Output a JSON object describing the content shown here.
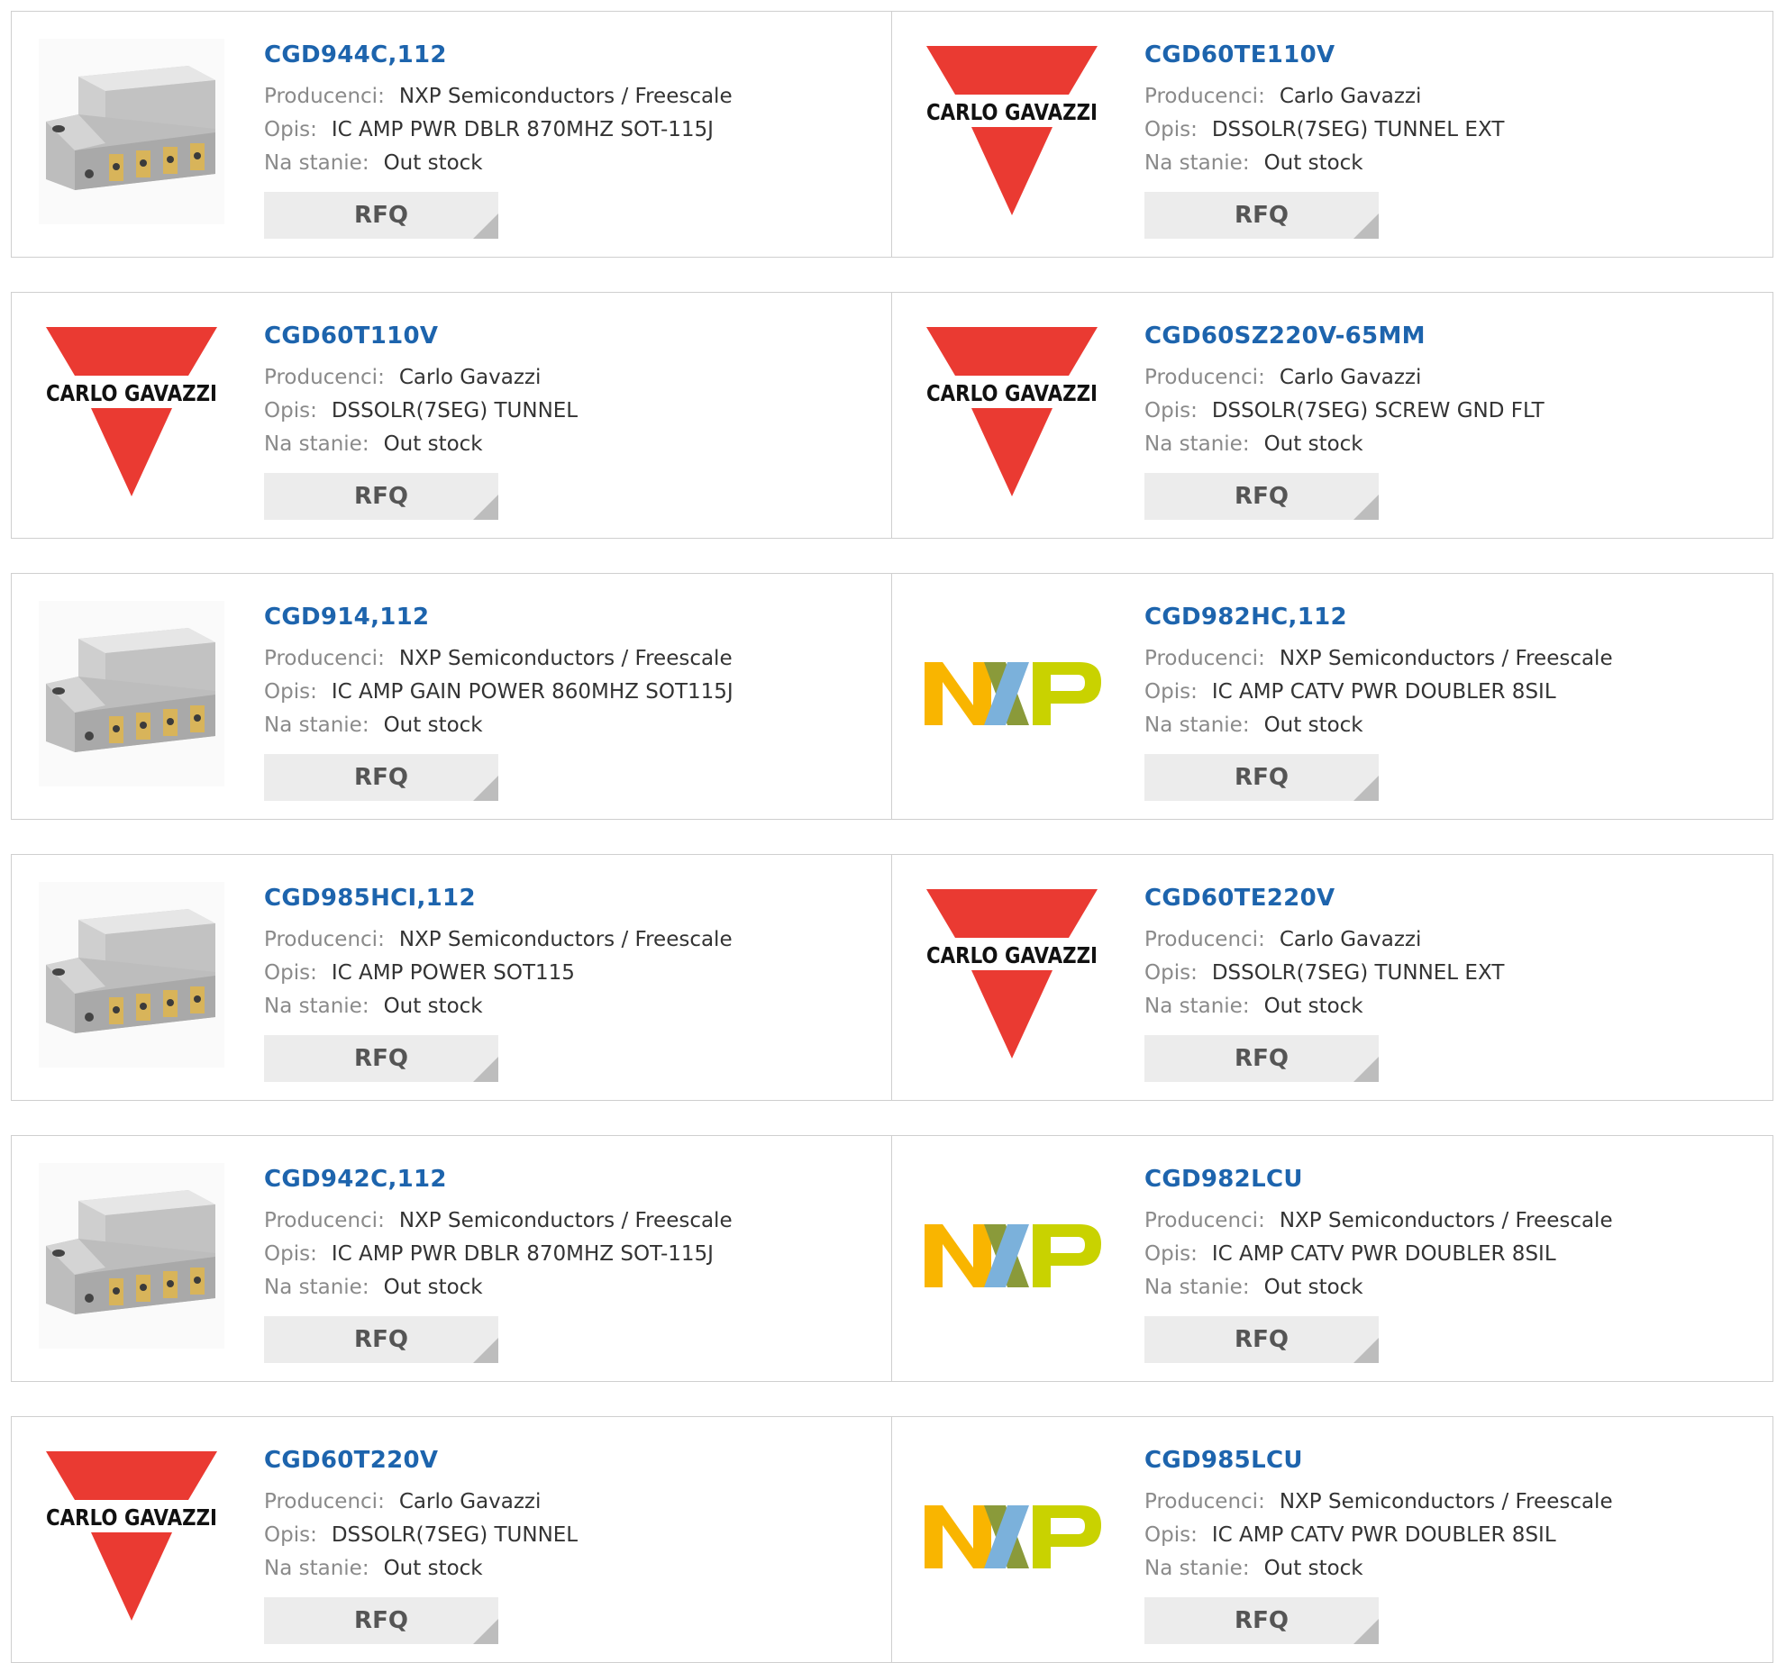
{
  "labels": {
    "manufacturer": "Producenci:",
    "description": "Opis:",
    "stock": "Na stanie:",
    "rfq": "RFQ"
  },
  "logo_text": {
    "carlo": "CARLO GAVAZZI"
  },
  "colors": {
    "part_link": "#1d64ad",
    "carlo_red": "#ea3a32",
    "nxp_yellow": "#f9b500",
    "nxp_blue": "#7bb1db",
    "nxp_green": "#c9d200"
  },
  "products": [
    {
      "part": "CGD944C,112",
      "manufacturer": "NXP Semiconductors / Freescale",
      "description": "IC AMP PWR DBLR 870MHZ SOT-115J",
      "stock": "Out stock",
      "image": "amplifier-module-image"
    },
    {
      "part": "CGD60TE110V",
      "manufacturer": "Carlo Gavazzi",
      "description": "DSSOLR(7SEG) TUNNEL EXT",
      "stock": "Out stock",
      "image": "carlo-gavazzi-logo"
    },
    {
      "part": "CGD60T110V",
      "manufacturer": "Carlo Gavazzi",
      "description": "DSSOLR(7SEG) TUNNEL",
      "stock": "Out stock",
      "image": "carlo-gavazzi-logo"
    },
    {
      "part": "CGD60SZ220V-65MM",
      "manufacturer": "Carlo Gavazzi",
      "description": "DSSOLR(7SEG) SCREW GND FLT",
      "stock": "Out stock",
      "image": "carlo-gavazzi-logo"
    },
    {
      "part": "CGD914,112",
      "manufacturer": "NXP Semiconductors / Freescale",
      "description": "IC AMP GAIN POWER 860MHZ SOT115J",
      "stock": "Out stock",
      "image": "amplifier-module-image"
    },
    {
      "part": "CGD982HC,112",
      "manufacturer": "NXP Semiconductors / Freescale",
      "description": "IC AMP CATV PWR DOUBLER 8SIL",
      "stock": "Out stock",
      "image": "nxp-logo"
    },
    {
      "part": "CGD985HCI,112",
      "manufacturer": "NXP Semiconductors / Freescale",
      "description": "IC AMP POWER SOT115",
      "stock": "Out stock",
      "image": "amplifier-module-image"
    },
    {
      "part": "CGD60TE220V",
      "manufacturer": "Carlo Gavazzi",
      "description": "DSSOLR(7SEG) TUNNEL EXT",
      "stock": "Out stock",
      "image": "carlo-gavazzi-logo"
    },
    {
      "part": "CGD942C,112",
      "manufacturer": "NXP Semiconductors / Freescale",
      "description": "IC AMP PWR DBLR 870MHZ SOT-115J",
      "stock": "Out stock",
      "image": "amplifier-module-image"
    },
    {
      "part": "CGD982LCU",
      "manufacturer": "NXP Semiconductors / Freescale",
      "description": "IC AMP CATV PWR DOUBLER 8SIL",
      "stock": "Out stock",
      "image": "nxp-logo"
    },
    {
      "part": "CGD60T220V",
      "manufacturer": "Carlo Gavazzi",
      "description": "DSSOLR(7SEG) TUNNEL",
      "stock": "Out stock",
      "image": "carlo-gavazzi-logo"
    },
    {
      "part": "CGD985LCU",
      "manufacturer": "NXP Semiconductors / Freescale",
      "description": "IC AMP CATV PWR DOUBLER 8SIL",
      "stock": "Out stock",
      "image": "nxp-logo"
    }
  ]
}
